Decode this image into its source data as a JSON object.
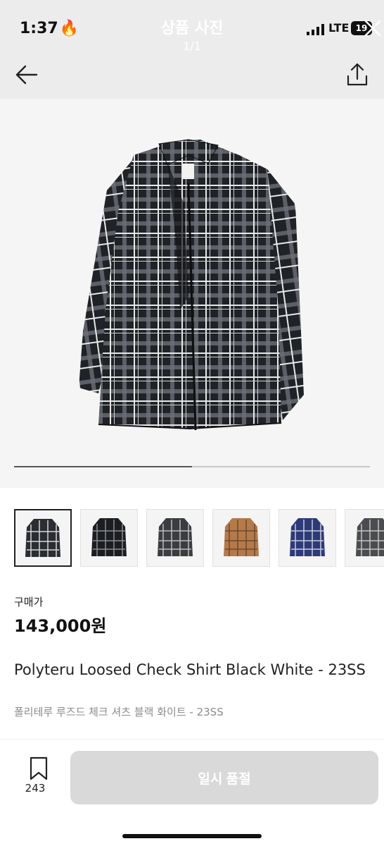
{
  "status": {
    "time": "1:37",
    "network": "LTE",
    "battery": "19"
  },
  "viewer": {
    "title": "상품 사진",
    "counter": "1/1"
  },
  "gallery": {
    "progress": 0.5,
    "thumbnails": [
      "black-white",
      "black-dark",
      "black-grey",
      "beige",
      "navy",
      "grey"
    ]
  },
  "product": {
    "price_label": "구매가",
    "price": "143,000원",
    "name_en": "Polyteru Loosed Check Shirt Black White - 23SS",
    "name_ko": "폴리테루 루즈드 체크 셔츠 블랙 화이트 - 23SS"
  },
  "bottom": {
    "bookmark_count": "243",
    "button_label": "일시 품절"
  },
  "icons": {
    "back": "arrow-left-icon",
    "share": "share-icon",
    "close": "close-icon",
    "bookmark": "bookmark-icon"
  },
  "colors": {
    "button_disabled": "#d9d9d9",
    "muted_text": "#8b8b8b"
  }
}
